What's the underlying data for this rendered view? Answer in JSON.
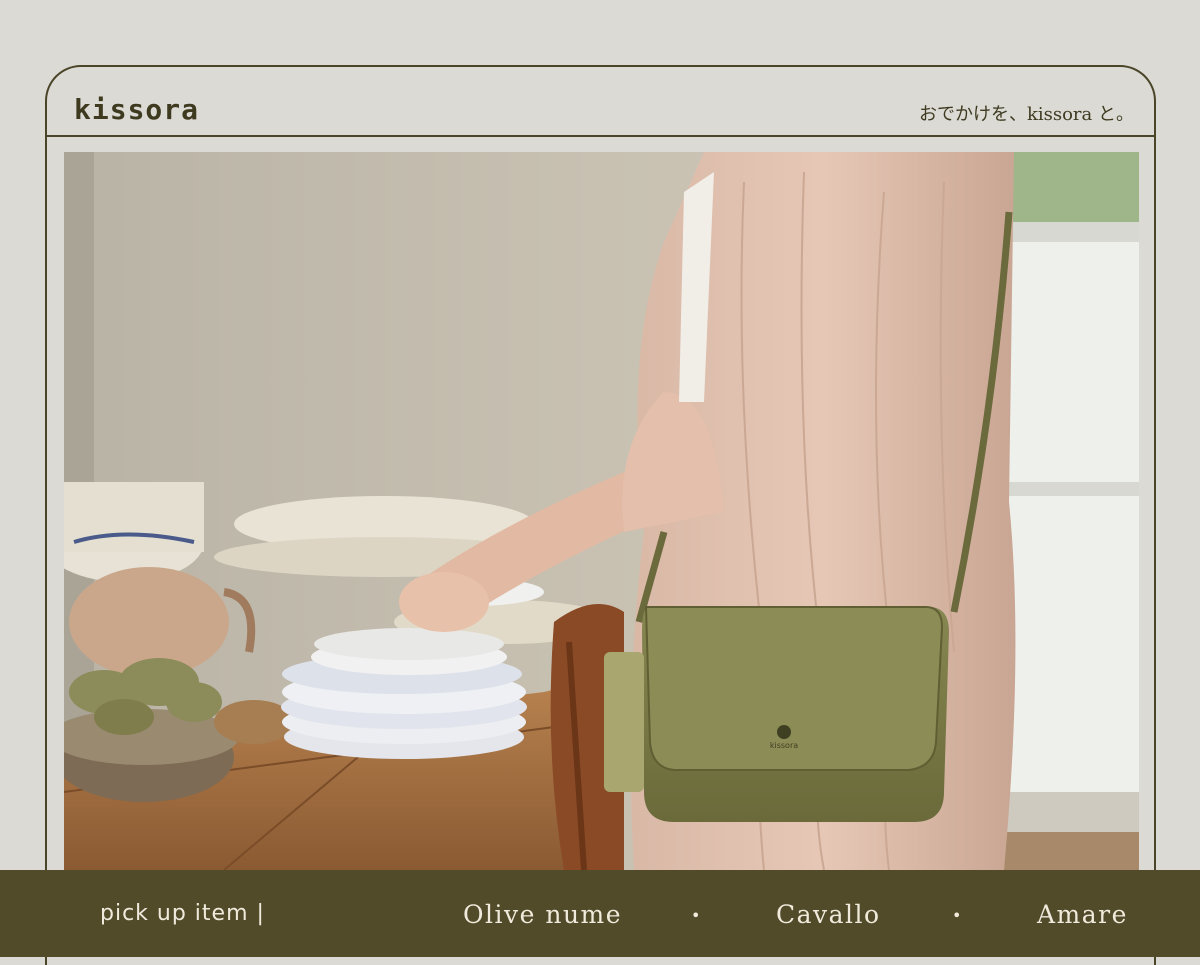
{
  "header": {
    "brand": "kissora",
    "tagline": "おでかけを、kissora と。"
  },
  "hero": {
    "bag_logo": "kissora"
  },
  "footer": {
    "label": "pick up item |",
    "items": [
      "Olive nume",
      "Cavallo",
      "Amare"
    ],
    "separator": "•"
  },
  "colors": {
    "background": "#dcdad5",
    "border": "#4a4528",
    "footer_bg": "#524b2a",
    "footer_text": "#efeadb",
    "bag": "#7a7a45"
  }
}
